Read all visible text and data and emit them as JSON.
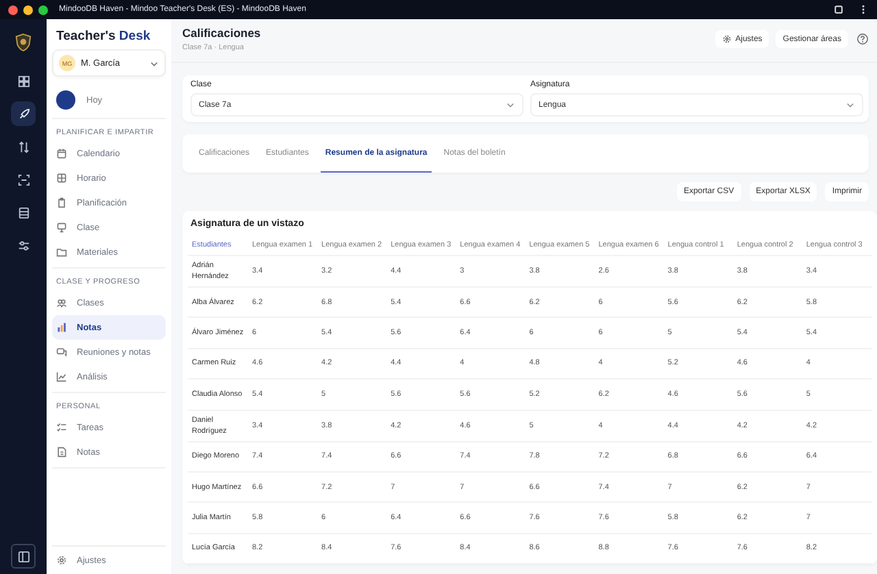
{
  "window": {
    "title": "MindooDB Haven - Mindoo Teacher's Desk (ES) - MindooDB Haven"
  },
  "sidebar": {
    "brand": {
      "plain": "Teacher's",
      "accent": "Desk"
    },
    "user": {
      "initials": "MG",
      "name": "M. García"
    },
    "today": "Hoy",
    "sections": [
      {
        "label": "PLANIFICAR E IMPARTIR",
        "items": [
          {
            "label": "Calendario",
            "selected": false
          },
          {
            "label": "Horario",
            "selected": false
          },
          {
            "label": "Planificación",
            "selected": false
          },
          {
            "label": "Clase",
            "selected": false
          },
          {
            "label": "Materiales",
            "selected": false
          }
        ]
      },
      {
        "label": "CLASE Y PROGRESO",
        "items": [
          {
            "label": "Clases",
            "selected": false
          },
          {
            "label": "Notas",
            "selected": true
          },
          {
            "label": "Reuniones y notas",
            "selected": false
          },
          {
            "label": "Análisis",
            "selected": false
          }
        ]
      },
      {
        "label": "PERSONAL",
        "items": [
          {
            "label": "Tareas",
            "selected": false
          },
          {
            "label": "Notas",
            "selected": false
          }
        ]
      }
    ],
    "footer": "Ajustes"
  },
  "header": {
    "title": "Calificaciones",
    "subtitle": "Clase 7a · Lengua",
    "actions": [
      "Ajustes",
      "Gestionar áreas"
    ]
  },
  "filters": [
    {
      "label": "Clase",
      "value": "Clase 7a"
    },
    {
      "label": "Asignatura",
      "value": "Lengua"
    }
  ],
  "tabs": [
    {
      "label": "Calificaciones",
      "selected": false
    },
    {
      "label": "Estudiantes",
      "selected": false
    },
    {
      "label": "Resumen de la asignatura",
      "selected": true
    },
    {
      "label": "Notas del boletín",
      "selected": false
    }
  ],
  "export_buttons": [
    "Exportar CSV",
    "Exportar XLSX",
    "Imprimir"
  ],
  "table": {
    "title": "Asignatura de un vistazo",
    "columns": [
      "Estudiantes",
      "Lengua examen 1",
      "Lengua examen 2",
      "Lengua examen 3",
      "Lengua examen 4",
      "Lengua examen 5",
      "Lengua examen 6",
      "Lengua control 1",
      "Lengua control 2",
      "Lengua control 3"
    ],
    "rows": [
      [
        "Adrián Hernández",
        "3.4",
        "3.2",
        "4.4",
        "3",
        "3.8",
        "2.6",
        "3.8",
        "3.8",
        "3.4"
      ],
      [
        "Alba Álvarez",
        "6.2",
        "6.8",
        "5.4",
        "6.6",
        "6.2",
        "6",
        "5.6",
        "6.2",
        "5.8"
      ],
      [
        "Álvaro Jiménez",
        "6",
        "5.4",
        "5.6",
        "6.4",
        "6",
        "6",
        "5",
        "5.4",
        "5.4"
      ],
      [
        "Carmen Ruiz",
        "4.6",
        "4.2",
        "4.4",
        "4",
        "4.8",
        "4",
        "5.2",
        "4.6",
        "4"
      ],
      [
        "Claudia Alonso",
        "5.4",
        "5",
        "5.6",
        "5.6",
        "5.2",
        "6.2",
        "4.6",
        "5.6",
        "5"
      ],
      [
        "Daniel Rodríguez",
        "3.4",
        "3.8",
        "4.2",
        "4.6",
        "5",
        "4",
        "4.4",
        "4.2",
        "4.2"
      ],
      [
        "Diego Moreno",
        "7.4",
        "7.4",
        "6.6",
        "7.4",
        "7.8",
        "7.2",
        "6.8",
        "6.6",
        "6.4"
      ],
      [
        "Hugo Martínez",
        "6.6",
        "7.2",
        "7",
        "7",
        "6.6",
        "7.4",
        "7",
        "6.2",
        "7"
      ],
      [
        "Julia Martín",
        "5.8",
        "6",
        "6.4",
        "6.6",
        "7.6",
        "7.6",
        "5.8",
        "6.2",
        "7"
      ],
      [
        "Lucía García",
        "8.2",
        "8.4",
        "7.6",
        "8.4",
        "8.6",
        "8.8",
        "7.6",
        "7.6",
        "8.2"
      ]
    ]
  }
}
